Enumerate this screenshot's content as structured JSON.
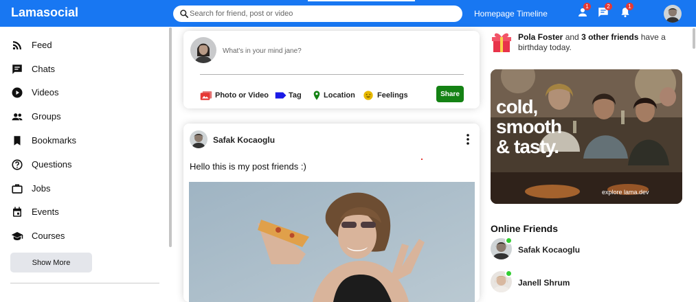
{
  "colors": {
    "brand": "#1877f2",
    "share_button": "#148214",
    "badge": "#e53935",
    "online": "#32cd32"
  },
  "topbar": {
    "logo": "Lamasocial",
    "search_placeholder": "Search for friend, post or video",
    "links": [
      "Homepage",
      "Timeline"
    ],
    "icons": [
      {
        "name": "person-icon",
        "badge": "1"
      },
      {
        "name": "chat-icon",
        "badge": "2"
      },
      {
        "name": "notifications-icon",
        "badge": "1"
      }
    ]
  },
  "sidebar": {
    "items": [
      {
        "label": "Feed",
        "icon": "rss-feed-icon"
      },
      {
        "label": "Chats",
        "icon": "chat-icon"
      },
      {
        "label": "Videos",
        "icon": "play-circle-icon"
      },
      {
        "label": "Groups",
        "icon": "group-icon"
      },
      {
        "label": "Bookmarks",
        "icon": "bookmark-icon"
      },
      {
        "label": "Questions",
        "icon": "help-outline-icon"
      },
      {
        "label": "Jobs",
        "icon": "work-outline-icon"
      },
      {
        "label": "Events",
        "icon": "event-icon"
      },
      {
        "label": "Courses",
        "icon": "school-icon"
      }
    ],
    "show_more": "Show More"
  },
  "share": {
    "placeholder": "What's in your mind jane?",
    "options": [
      {
        "label": "Photo or Video",
        "icon": "perm-media-icon",
        "color": "#e53935"
      },
      {
        "label": "Tag",
        "icon": "label-icon",
        "color": "#1a1ae6"
      },
      {
        "label": "Location",
        "icon": "room-icon",
        "color": "#148214"
      },
      {
        "label": "Feelings",
        "icon": "emoji-emotions-icon",
        "color": "#e6b800"
      }
    ],
    "button": "Share"
  },
  "post": {
    "username": "Safak Kocaoglu",
    "text": "Hello this is my post friends :)"
  },
  "rightbar": {
    "birthday": {
      "name": "Pola Foster",
      "middle": " and ",
      "others": "3 other friends",
      "tail": " have a birthday today."
    },
    "ad": {
      "lines": [
        "cold,",
        "smooth",
        "& tasty."
      ],
      "footer": "explore lama.dev"
    },
    "online_title": "Online Friends",
    "friends": [
      "Safak Kocaoglu",
      "Janell Shrum"
    ]
  }
}
